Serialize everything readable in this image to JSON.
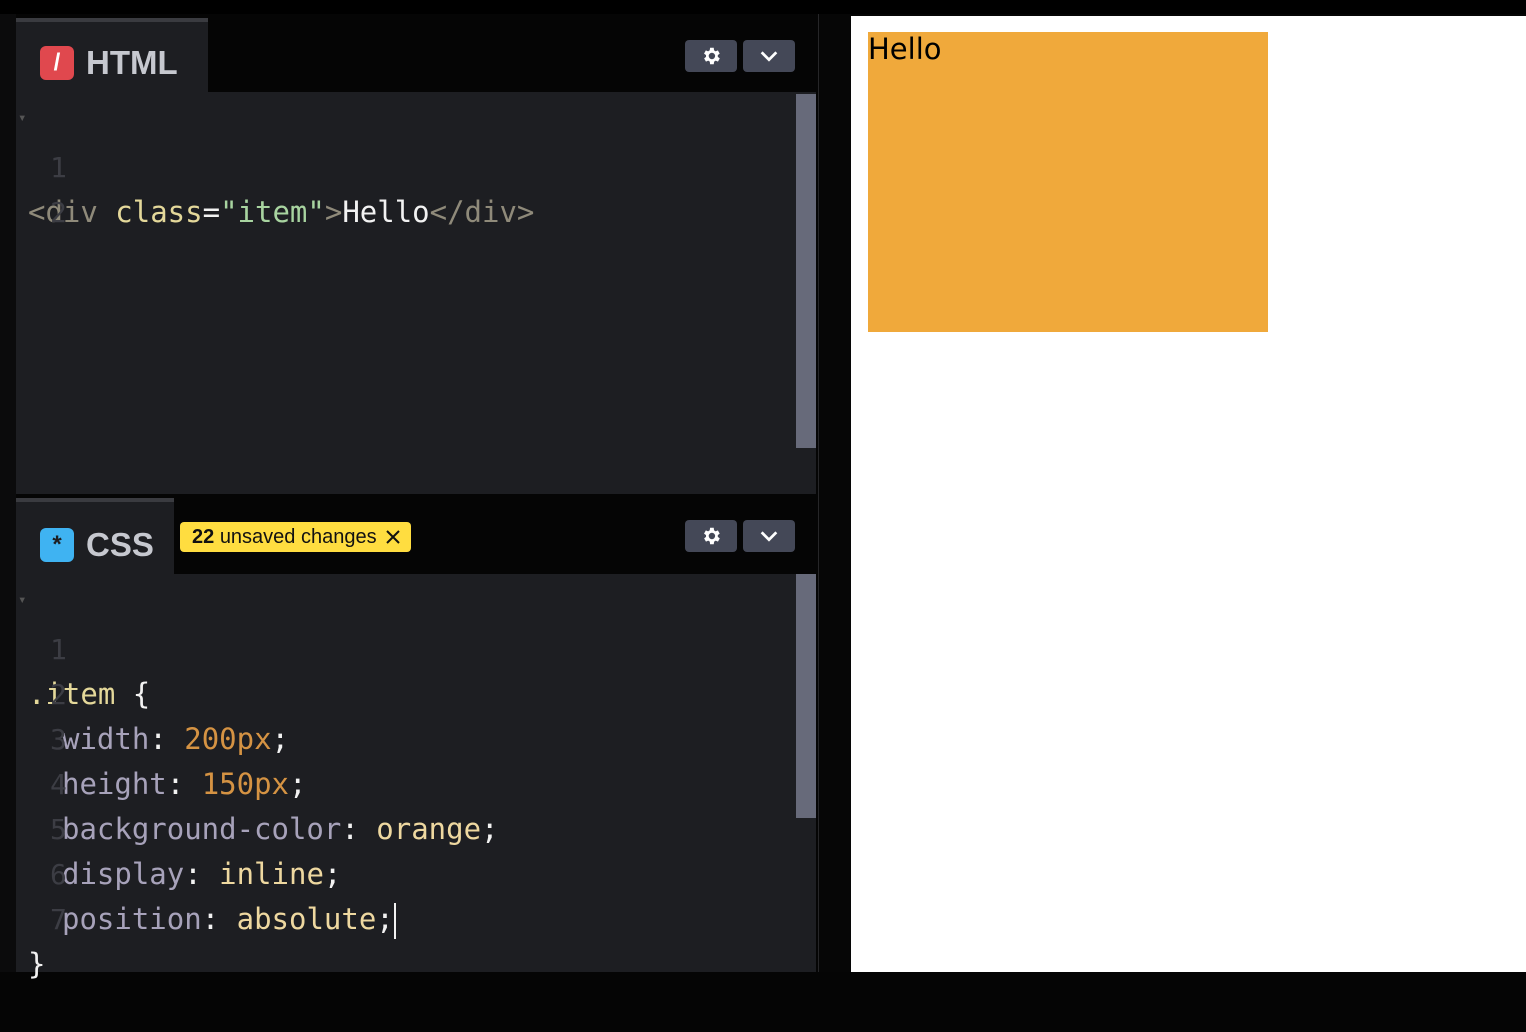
{
  "html_panel": {
    "title": "HTML",
    "icon": "slash-icon",
    "icon_glyph": "/",
    "code_line_1": {
      "open_tag": "<div",
      "attr": " class",
      "eq": "=",
      "value": "\"item\"",
      "gt": ">",
      "text": "Hello",
      "close_tag": "</div>"
    },
    "line_numbers": [
      "1",
      "2"
    ]
  },
  "css_panel": {
    "title": "CSS",
    "icon": "asterisk-icon",
    "icon_glyph": "*",
    "unsaved_count": "22",
    "unsaved_text": "unsaved changes",
    "selector": ".item",
    "open_brace": "{",
    "close_brace": "}",
    "declarations": [
      {
        "prop": "width",
        "value": "200px",
        "kind": "num"
      },
      {
        "prop": "height",
        "value": "150px",
        "kind": "num"
      },
      {
        "prop": "background-color",
        "value": "orange",
        "kind": "kw"
      },
      {
        "prop": "display",
        "value": "inline",
        "kind": "kw"
      },
      {
        "prop": "position",
        "value": "absolute",
        "kind": "kw"
      }
    ],
    "line_numbers": [
      "1",
      "2",
      "3",
      "4",
      "5",
      "6",
      "7"
    ]
  },
  "preview": {
    "item_text": "Hello",
    "item_color": "#f0a93b"
  },
  "colors": {
    "badge": "#ffdd40",
    "html_icon": "#e0484e",
    "css_icon": "#3fb3f2"
  }
}
